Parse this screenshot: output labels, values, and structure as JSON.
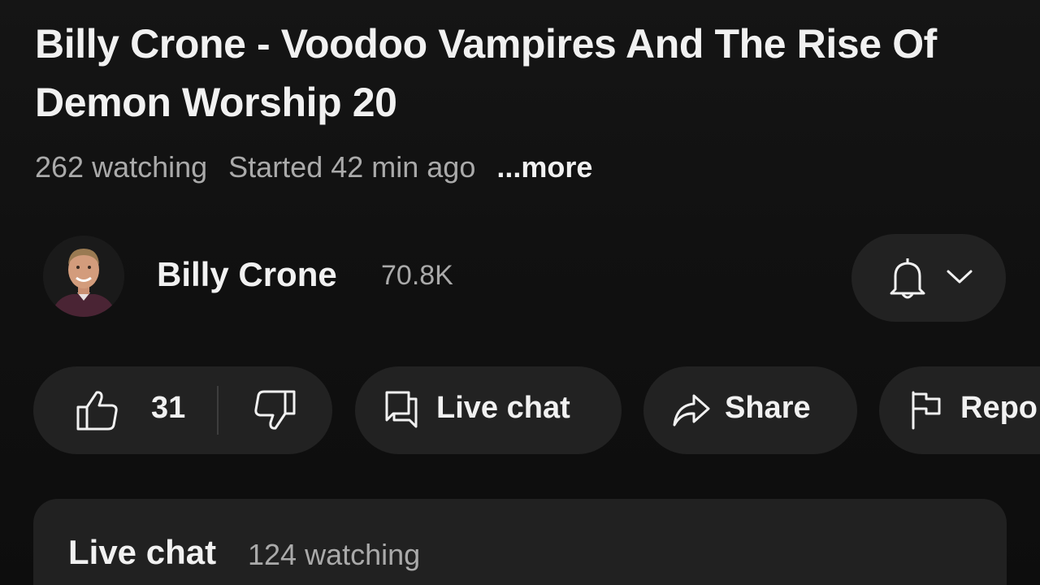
{
  "video": {
    "title": "Billy Crone - Voodoo Vampires And The Rise Of Demon Worship 20",
    "watching": "262 watching",
    "started": "Started 42 min ago",
    "more_label": "...more"
  },
  "channel": {
    "name": "Billy Crone",
    "subscribers": "70.8K",
    "avatar_icon": "channel-avatar",
    "notify_icon": "bell-icon",
    "dropdown_icon": "chevron-down-icon"
  },
  "actions": {
    "like_count": "31",
    "like_icon": "thumbs-up-icon",
    "dislike_icon": "thumbs-down-icon",
    "live_chat_label": "Live chat",
    "live_chat_icon": "chat-icon",
    "share_label": "Share",
    "share_icon": "share-icon",
    "report_label": "Repo",
    "report_icon": "flag-icon"
  },
  "live_chat_panel": {
    "title": "Live chat",
    "watching": "124 watching"
  },
  "colors": {
    "background": "#0f0f0f",
    "pill": "#222222",
    "text_primary": "#f1f1f1",
    "text_secondary": "#aaaaaa"
  }
}
